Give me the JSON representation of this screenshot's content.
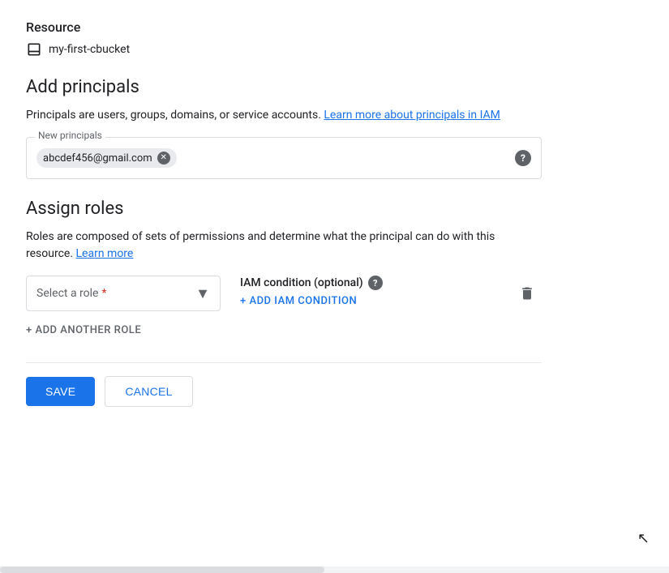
{
  "resource": {
    "label": "Resource",
    "bucket_name": "my-first-cbucket"
  },
  "add_principals": {
    "heading": "Add principals",
    "description_start": "Principals are users, groups, domains, or service accounts.",
    "learn_more_link": "Learn more about principals in IAM",
    "field_label": "New principals",
    "chip_email": "abcdef456@gmail.com",
    "help_icon": "?"
  },
  "assign_roles": {
    "heading": "Assign roles",
    "description": "Roles are composed of sets of permissions and determine what the principal can do with this resource.",
    "learn_more_link": "Learn more",
    "select_placeholder": "Select a role",
    "required_star": "*",
    "iam_condition_label": "IAM condition (optional)",
    "add_iam_condition": "+ ADD IAM CONDITION",
    "add_another_role": "+ ADD ANOTHER ROLE"
  },
  "actions": {
    "save_label": "SAVE",
    "cancel_label": "CANCEL"
  }
}
